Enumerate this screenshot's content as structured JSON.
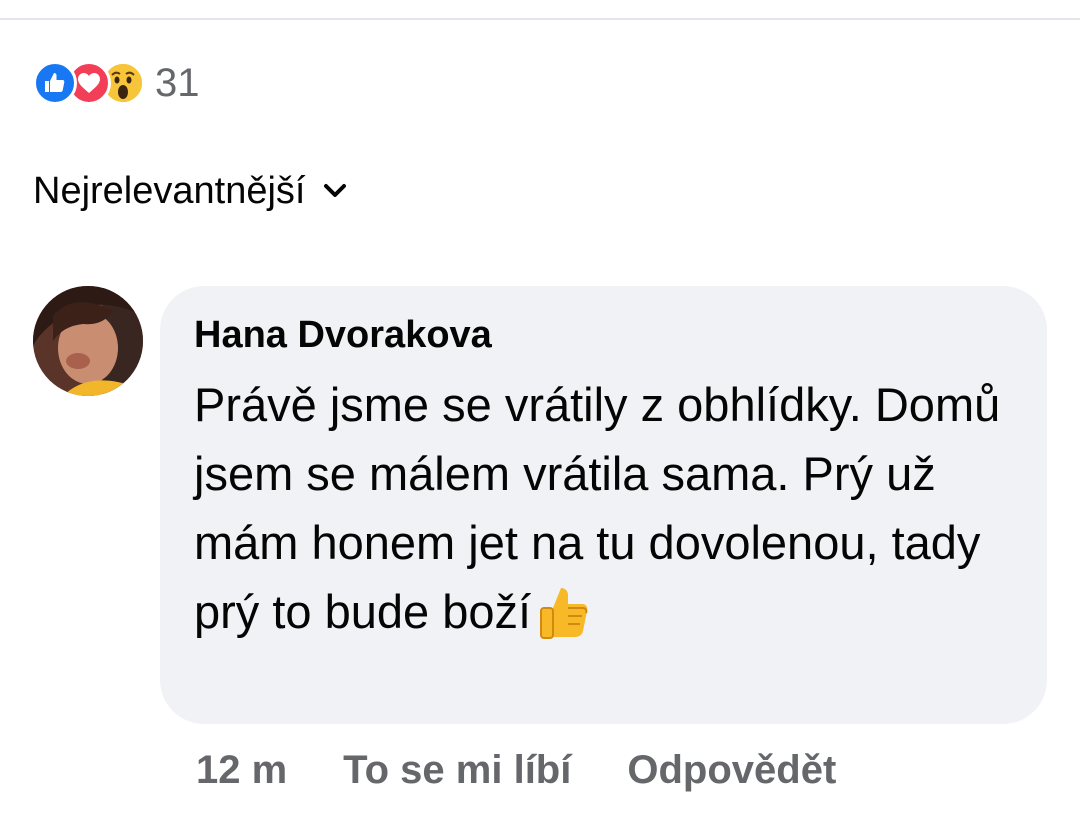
{
  "reactions": {
    "icons": [
      "thumbs-up-icon",
      "heart-icon",
      "wow-face-icon"
    ],
    "count": "31"
  },
  "sort": {
    "label": "Nejrelevantnější"
  },
  "comment": {
    "author": "Hana Dvorakova",
    "text": "Právě jsme se vrátily z obhlídky. Domů jsem se málem vrátila sama. Prý už mám honem jet na tu dovolenou, tady prý to bude boží",
    "emoji": "thumbs-up-emoji",
    "time": "12 m",
    "like_label": "To se mi líbí",
    "reply_label": "Odpovědět"
  },
  "colors": {
    "like_blue": "#1877f2",
    "love_red": "#f33e58",
    "wow_yellow": "#f7b125",
    "bubble_bg": "#f0f2f5",
    "secondary_text": "#65676b"
  }
}
